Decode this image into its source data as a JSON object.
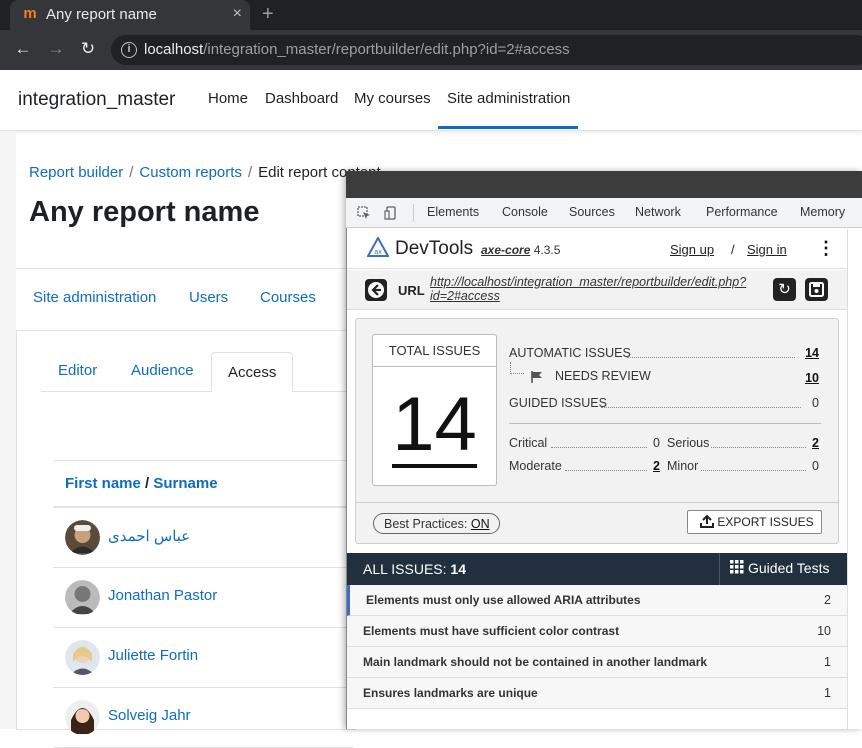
{
  "browser": {
    "tab_title": "Any report name",
    "tab_close": "×",
    "new_tab": "+",
    "url_host": "localhost",
    "url_path": "/integration_master/reportbuilder/edit.php?id=2#access"
  },
  "moodle": {
    "site_name": "integration_master",
    "nav": [
      "Home",
      "Dashboard",
      "My courses",
      "Site administration"
    ],
    "breadcrumb": [
      "Report builder",
      "Custom reports",
      "Edit report content"
    ],
    "page_title": "Any report name",
    "secondary_nav": [
      "Site administration",
      "Users",
      "Courses"
    ],
    "report_tabs": [
      "Editor",
      "Audience",
      "Access"
    ],
    "table": {
      "col_first": "First name",
      "col_sep": " / ",
      "col_last": "Surname",
      "users": [
        "عباس احمدی",
        "Jonathan Pastor",
        "Juliette Fortin",
        "Solveig Jahr"
      ]
    }
  },
  "devtools": {
    "tabs": [
      "Elements",
      "Console",
      "Sources",
      "Network",
      "Performance",
      "Memory"
    ],
    "axe": {
      "title": "DevTools",
      "core_name": "axe-core",
      "core_version": "4.3.5",
      "sign_up": "Sign up",
      "separator": "/",
      "sign_in": "Sign in",
      "url_label": "URL",
      "url_value": "http://localhost/integration_master/reportbuilder/edit.php?id=2#access",
      "total_label": "TOTAL ISSUES",
      "total": "14",
      "automatic_label": "AUTOMATIC ISSUES",
      "automatic": "14",
      "needs_review_label": "NEEDS REVIEW",
      "needs_review": "10",
      "guided_label": "GUIDED ISSUES",
      "guided": "0",
      "critical_label": "Critical",
      "critical": "0",
      "serious_label": "Serious",
      "serious": "2",
      "moderate_label": "Moderate",
      "moderate": "2",
      "minor_label": "Minor",
      "minor": "0",
      "best_practices_label": "Best Practices:",
      "best_practices_value": "ON",
      "export_label": "EXPORT ISSUES",
      "all_issues_label": "ALL ISSUES:",
      "all_issues_count": "14",
      "guided_tests_label": "Guided Tests",
      "issues": [
        {
          "title": "Elements must only use allowed ARIA attributes",
          "count": "2"
        },
        {
          "title": "Elements must have sufficient color contrast",
          "count": "10"
        },
        {
          "title": "Main landmark should not be contained in another landmark",
          "count": "1"
        },
        {
          "title": "Ensures landmarks are unique",
          "count": "1"
        }
      ]
    }
  },
  "colors": {
    "moodle_link": "#0f6cbf",
    "axe_dark": "#222f3e",
    "chrome_dark": "#202124"
  }
}
